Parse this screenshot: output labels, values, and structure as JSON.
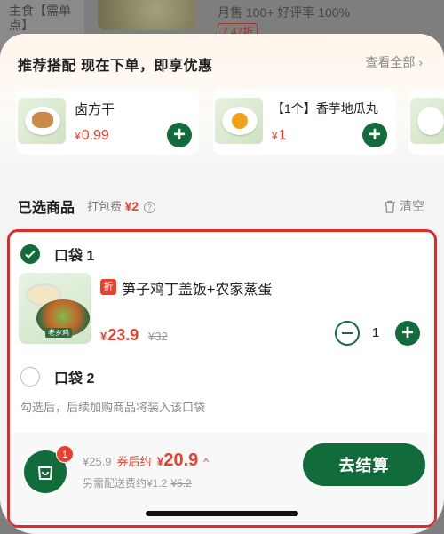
{
  "background": {
    "category": "主食【需单点】",
    "sales": "月售 100+ 好评率 100%",
    "price_tag": "7.47折"
  },
  "recommend": {
    "title": "推荐搭配  现在下单，即享优惠",
    "view_all": "查看全部",
    "items": [
      {
        "name": "卤方干",
        "currency": "¥",
        "price": "0.99",
        "food_color": "#c98a4a"
      },
      {
        "name": "【1个】香芋地瓜丸",
        "currency": "¥",
        "price": "1",
        "food_color": "#f0a21a"
      }
    ]
  },
  "selected": {
    "title": "已选商品",
    "pack_fee_label": "打包费",
    "pack_fee": "¥2",
    "help_icon": "?",
    "clear": "清空"
  },
  "bag1": {
    "label": "口袋 1",
    "item": {
      "badge": "折",
      "name": "笋子鸡丁盖饭+农家蒸蛋",
      "brand": "老乡鸡",
      "currency": "¥",
      "price": "23.9",
      "original_price": "¥32",
      "quantity": "1"
    }
  },
  "bag2": {
    "label": "口袋 2",
    "hint": "勾选后，后续加购商品将装入该口袋"
  },
  "bottom": {
    "cart_count": "1",
    "original_total": "¥25.9",
    "after_coupon_label": "券后约",
    "currency": "¥",
    "total": "20.9",
    "caret": "^",
    "delivery_label": "另需配送费约¥1.2",
    "delivery_original": "¥5.2",
    "checkout": "去结算"
  },
  "colors": {
    "brand_green": "#126b3a",
    "accent_red": "#e8402f",
    "frame_red": "#e02a2a"
  }
}
